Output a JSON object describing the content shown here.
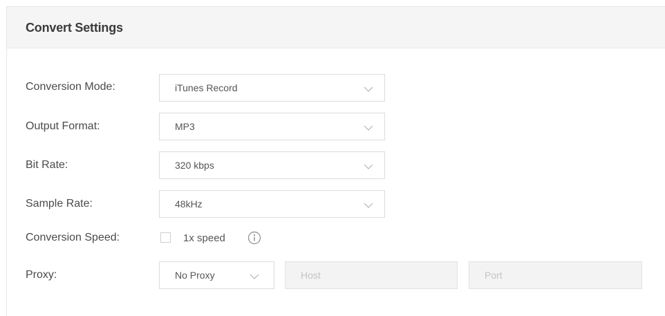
{
  "panel": {
    "title": "Convert Settings"
  },
  "settings": {
    "conversion_mode": {
      "label": "Conversion Mode:",
      "value": "iTunes Record"
    },
    "output_format": {
      "label": "Output Format:",
      "value": "MP3"
    },
    "bit_rate": {
      "label": "Bit Rate:",
      "value": "320 kbps"
    },
    "sample_rate": {
      "label": "Sample Rate:",
      "value": "48kHz"
    },
    "conversion_speed": {
      "label": "Conversion Speed:",
      "checkbox_label": "1x speed",
      "checked": false
    },
    "proxy": {
      "label": "Proxy:",
      "value": "No Proxy",
      "host_placeholder": "Host",
      "port_placeholder": "Port"
    }
  },
  "icons": {
    "dropdown": "chevron-down-icon",
    "info": "info-icon"
  },
  "colors": {
    "header_bg": "#f5f5f5",
    "border": "#dcdcdc",
    "disabled_field_bg": "#f3f3f3"
  }
}
